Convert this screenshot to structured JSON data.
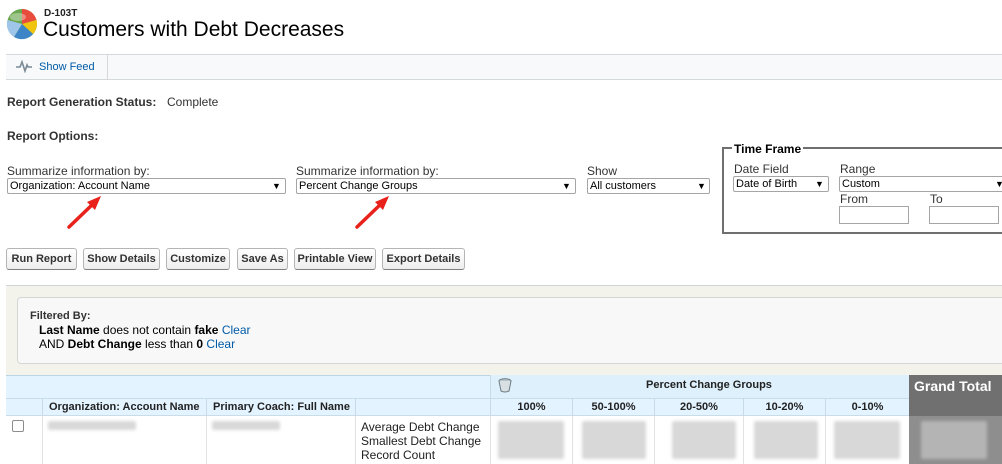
{
  "header": {
    "report_id": "D-103T",
    "title": "Customers with Debt Decreases"
  },
  "feed": {
    "show_feed_label": "Show Feed"
  },
  "status": {
    "label": "Report Generation Status:",
    "value": "Complete"
  },
  "options": {
    "heading": "Report Options:",
    "summarize_1": {
      "label": "Summarize information by:",
      "value": "Organization: Account Name"
    },
    "summarize_2": {
      "label": "Summarize information by:",
      "value": "Percent Change Groups"
    },
    "show": {
      "label": "Show",
      "value": "All customers"
    }
  },
  "time_frame": {
    "legend": "Time Frame",
    "date_field": {
      "label": "Date Field",
      "value": "Date of Birth"
    },
    "range": {
      "label": "Range",
      "value": "Custom"
    },
    "from_label": "From",
    "to_label": "To"
  },
  "buttons": {
    "run_report": "Run Report",
    "show_details": "Show Details",
    "customize": "Customize",
    "save_as": "Save As",
    "printable_view": "Printable View",
    "export_details": "Export Details"
  },
  "filters": {
    "title": "Filtered By:",
    "line1": {
      "field": "Last Name",
      "op": " does not contain ",
      "value": "fake",
      "clear": "Clear"
    },
    "line2": {
      "prefix": "AND ",
      "field": "Debt Change",
      "op": " less than ",
      "value": "0",
      "clear": "Clear"
    }
  },
  "table": {
    "group_header": "Percent Change Groups",
    "grand_total": "Grand Total",
    "columns": {
      "account": "Organization: Account Name",
      "coach": "Primary Coach: Full Name",
      "groups": [
        "100%",
        "50-100%",
        "20-50%",
        "10-20%",
        "0-10%"
      ]
    },
    "metrics": [
      "Average Debt Change",
      "Smallest Debt Change",
      "Record Count"
    ]
  },
  "colors": {
    "link": "#015ba7",
    "table_header_bg": "#e3f3ff",
    "grand_total_bg": "#707070",
    "annotation_arrow": "#e8221b"
  },
  "icons": {
    "logo": "report-logo-icon",
    "feed": "feed-pulse-icon",
    "group_toggle": "bucket-icon",
    "arrow": "red-arrow-icon"
  }
}
